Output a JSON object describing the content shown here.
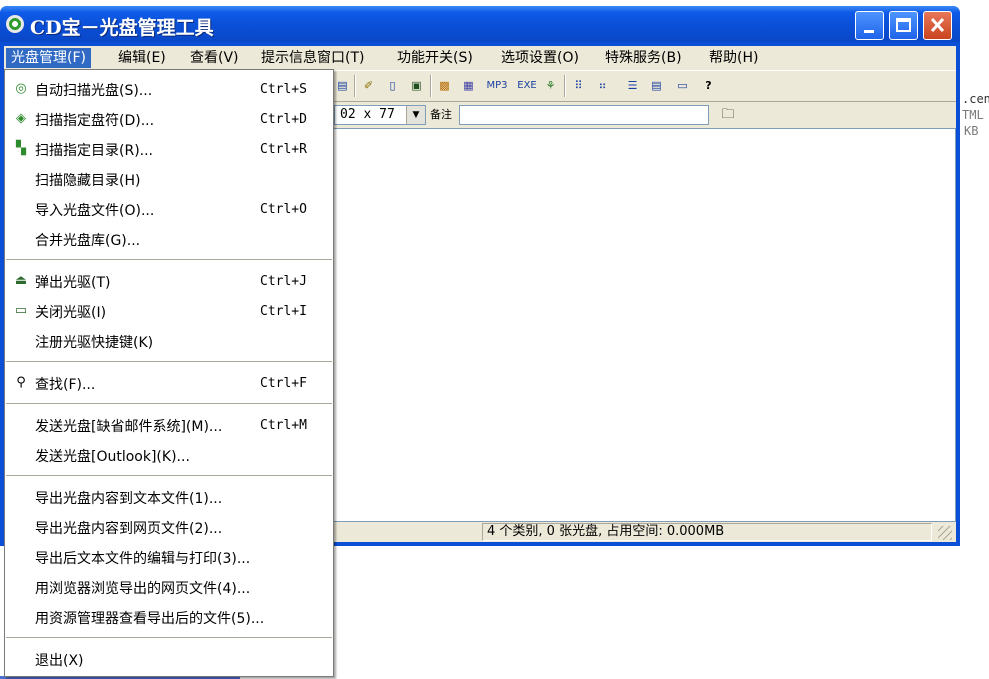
{
  "window": {
    "title": "CD宝－光盘管理工具"
  },
  "menubar": [
    {
      "label": "光盘管理(F)"
    },
    {
      "label": "编辑(E)"
    },
    {
      "label": "查看(V)"
    },
    {
      "label": "提示信息窗口(T)"
    },
    {
      "label": "功能开关(S)"
    },
    {
      "label": "选项设置(O)"
    },
    {
      "label": "特殊服务(B)"
    },
    {
      "label": "帮助(H)"
    }
  ],
  "toolbar": {
    "buttons": [
      "mp3-icon",
      "exe-icon",
      "help-icon"
    ],
    "mp3_label": "MP3",
    "exe_label": "EXE"
  },
  "toolbar2": {
    "size_value": "02 x 77",
    "note_label": "备注",
    "note_value": ""
  },
  "dropdown": {
    "items": [
      {
        "label": "自动扫描光盘(S)...",
        "shortcut": "Ctrl+S",
        "icon": "cd-scan-icon"
      },
      {
        "label": "扫描指定盘符(D)...",
        "shortcut": "Ctrl+D",
        "icon": "drive-scan-icon"
      },
      {
        "label": "扫描指定目录(R)...",
        "shortcut": "Ctrl+R",
        "icon": "folder-scan-icon"
      },
      {
        "label": "扫描隐藏目录(H)",
        "shortcut": "",
        "icon": ""
      },
      {
        "label": "导入光盘文件(O)...",
        "shortcut": "Ctrl+O",
        "icon": ""
      },
      {
        "label": "合并光盘库(G)...",
        "shortcut": "",
        "icon": ""
      },
      {
        "label": "弹出光驱(T)",
        "shortcut": "Ctrl+J",
        "icon": "eject-icon"
      },
      {
        "label": "关闭光驱(I)",
        "shortcut": "Ctrl+I",
        "icon": "close-tray-icon"
      },
      {
        "label": "注册光驱快捷键(K)",
        "shortcut": "",
        "icon": ""
      },
      {
        "label": "查找(F)...",
        "shortcut": "Ctrl+F",
        "icon": "binoculars-icon"
      },
      {
        "label": "发送光盘[缺省邮件系统](M)...",
        "shortcut": "Ctrl+M",
        "icon": ""
      },
      {
        "label": "发送光盘[Outlook](K)...",
        "shortcut": "",
        "icon": ""
      },
      {
        "label": "导出光盘内容到文本文件(1)...",
        "shortcut": "",
        "icon": ""
      },
      {
        "label": "导出光盘内容到网页文件(2)...",
        "shortcut": "",
        "icon": ""
      },
      {
        "label": "导出后文本文件的编辑与打印(3)...",
        "shortcut": "",
        "icon": ""
      },
      {
        "label": "用浏览器浏览导出的网页文件(4)...",
        "shortcut": "",
        "icon": ""
      },
      {
        "label": "用资源管理器查看导出后的文件(5)...",
        "shortcut": "",
        "icon": ""
      },
      {
        "label": "退出(X)",
        "shortcut": "",
        "icon": ""
      }
    ]
  },
  "statusbar": {
    "text": "4 个类别, 0 张光盘, 占用空间: 0.000MB"
  },
  "background": {
    "line1": ".cen",
    "line2": "TML",
    "line3": "KB"
  },
  "colors": {
    "titlebar": "#0a4fd6",
    "menu_highlight": "#316ac5",
    "chrome": "#ece9d8"
  }
}
